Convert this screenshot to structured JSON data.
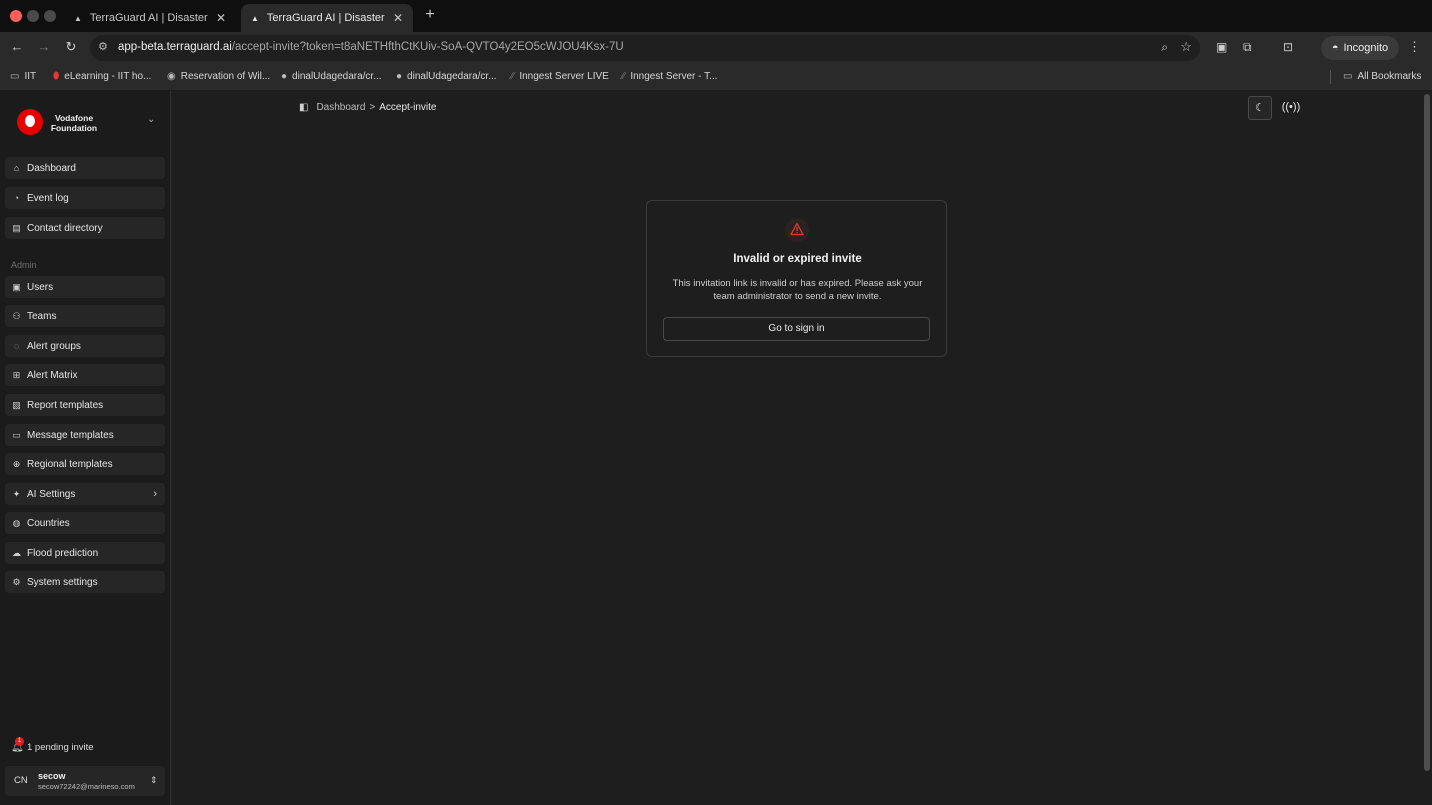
{
  "browser": {
    "tabs": [
      {
        "title": "TerraGuard AI | Disaster Risk",
        "close": "✕"
      },
      {
        "title": "TerraGuard AI | Disaster Risk",
        "close": "✕"
      }
    ],
    "new_tab": "+",
    "url_host": "app-beta.terraguard.ai",
    "url_path": "/accept-invite?token=t8aNETHfthCtKUiv-SoA-QVTO4y2EO5cWJOU4Ksx-7U",
    "incognito_label": "Incognito",
    "all_bookmarks": "All Bookmarks",
    "bookmarks": [
      {
        "label": "IIT",
        "icon": "folder-icon"
      },
      {
        "label": "eLearning - IIT ho...",
        "icon": "shield-icon"
      },
      {
        "label": "Reservation of Wil...",
        "icon": "globe-icon"
      },
      {
        "label": "dinalUdagedara/cr...",
        "icon": "github-icon"
      },
      {
        "label": "dinalUdagedara/cr...",
        "icon": "github-icon"
      },
      {
        "label": "Inngest Server LIVE",
        "icon": "inngest-icon"
      },
      {
        "label": "Inngest Server - T...",
        "icon": "inngest-icon"
      }
    ]
  },
  "org": {
    "name": "Vodafone Foundation"
  },
  "sidebar": {
    "primary": [
      {
        "label": "Dashboard",
        "icon": "home-icon"
      },
      {
        "label": "Event log",
        "icon": "event-log-icon"
      },
      {
        "label": "Contact directory",
        "icon": "contact-book-icon"
      }
    ],
    "section_label": "Admin",
    "admin": [
      {
        "label": "Users",
        "icon": "user-badge-icon"
      },
      {
        "label": "Teams",
        "icon": "team-icon"
      },
      {
        "label": "Alert groups",
        "icon": "alert-group-icon"
      },
      {
        "label": "Alert Matrix",
        "icon": "matrix-icon"
      },
      {
        "label": "Report templates",
        "icon": "report-icon"
      },
      {
        "label": "Message templates",
        "icon": "message-icon"
      },
      {
        "label": "Regional templates",
        "icon": "globe-icon"
      },
      {
        "label": "AI Settings",
        "icon": "sparkles-icon",
        "has_submenu": true
      },
      {
        "label": "Countries",
        "icon": "countries-icon"
      },
      {
        "label": "Flood prediction",
        "icon": "cloud-icon"
      },
      {
        "label": "System settings",
        "icon": "gear-icon"
      }
    ],
    "pending_invite": {
      "count": "1",
      "label": "1 pending invite"
    },
    "user": {
      "initials": "CN",
      "name": "secow",
      "email": "secow72242@marineso.com"
    }
  },
  "breadcrumb": {
    "root": "Dashboard",
    "separator": ">",
    "current": "Accept-invite"
  },
  "invite_card": {
    "title": "Invalid or expired invite",
    "message": "This invitation link is invalid or has expired. Please ask your team administrator to send a new invite.",
    "button_label": "Go to sign in"
  },
  "colors": {
    "brand_red": "#e60000",
    "warning_red": "#e53935",
    "background": "#1e1e1e"
  }
}
